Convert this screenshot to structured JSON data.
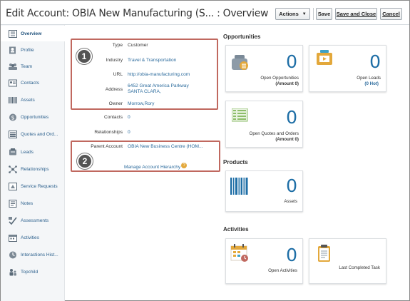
{
  "header": {
    "title": "Edit Account: OBIA New Manufacturing (S... : Overview",
    "actions_label": "Actions",
    "save_label": "Save",
    "save_close_label": "Save and Close",
    "cancel_label": "Cancel"
  },
  "sidebar": {
    "items": [
      {
        "label": "Overview",
        "icon": "overview-icon",
        "active": true
      },
      {
        "label": "Profile",
        "icon": "profile-icon"
      },
      {
        "label": "Team",
        "icon": "team-icon"
      },
      {
        "label": "Contacts",
        "icon": "contacts-icon"
      },
      {
        "label": "Assets",
        "icon": "assets-icon"
      },
      {
        "label": "Opportunities",
        "icon": "opportunities-icon"
      },
      {
        "label": "Quotes and Ord...",
        "icon": "quotes-icon"
      },
      {
        "label": "Leads",
        "icon": "leads-icon"
      },
      {
        "label": "Relationships",
        "icon": "relationships-icon"
      },
      {
        "label": "Service Requests",
        "icon": "service-requests-icon"
      },
      {
        "label": "Notes",
        "icon": "notes-icon"
      },
      {
        "label": "Assessments",
        "icon": "assessments-icon"
      },
      {
        "label": "Activities",
        "icon": "activities-icon"
      },
      {
        "label": "Interactions Hist...",
        "icon": "interactions-icon"
      },
      {
        "label": "Topchild",
        "icon": "topchild-icon"
      }
    ]
  },
  "profile": {
    "type_label": "Type",
    "type_value": "Customer",
    "industry_label": "Industry",
    "industry_value": "Travel & Transportation",
    "url_label": "URL",
    "url_value": "http://obia-manufacturing.com",
    "address_label": "Address",
    "address_line1": "6452 Great America Parkway",
    "address_line2": "SANTA CLARA,",
    "owner_label": "Owner",
    "owner_value": "Morrow,Rory",
    "contacts_label": "Contacts",
    "contacts_value": "0",
    "relationships_label": "Relationships",
    "relationships_value": "0",
    "parent_label": "Parent Account",
    "parent_value": "OBIA New Business Centre (HOM...",
    "hierarchy_link": "Manage Account Hierarchy",
    "callout1": "1",
    "callout2": "2"
  },
  "opportunities": {
    "title": "Opportunities",
    "open_opps_count": "0",
    "open_opps_label": "Open Opportunities",
    "open_opps_amount": "(Amount 0)",
    "open_leads_count": "0",
    "open_leads_label": "Open Leads",
    "open_leads_hot": "(0 Hot)",
    "quotes_count": "0",
    "quotes_label": "Open Quotes and Orders",
    "quotes_amount": "(Amount 0)"
  },
  "products": {
    "title": "Products",
    "assets_count": "0",
    "assets_label": "Assets"
  },
  "activities": {
    "title": "Activities",
    "open_count": "0",
    "open_label": "Open Activities",
    "last_task_label": "Last Completed Task"
  },
  "colors": {
    "link": "#2a6a9c",
    "number": "#1e6ea6",
    "highlight_box": "#c0685f"
  }
}
